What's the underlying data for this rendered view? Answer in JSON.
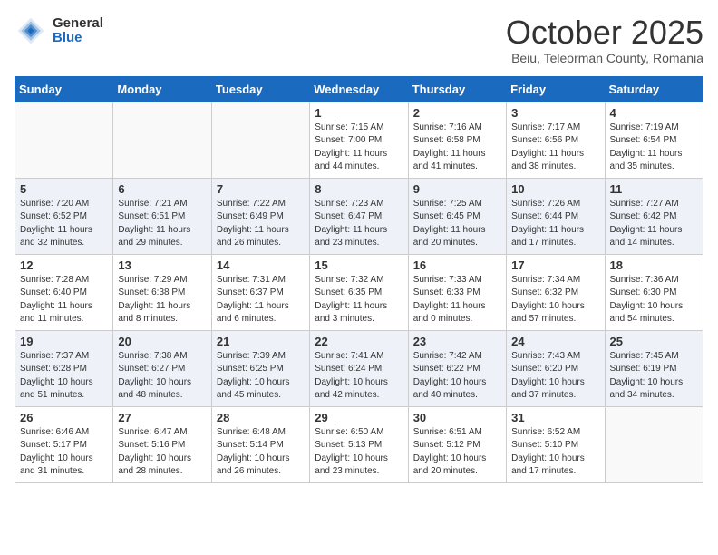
{
  "header": {
    "logo_general": "General",
    "logo_blue": "Blue",
    "month_title": "October 2025",
    "location": "Beiu, Teleorman County, Romania"
  },
  "weekdays": [
    "Sunday",
    "Monday",
    "Tuesday",
    "Wednesday",
    "Thursday",
    "Friday",
    "Saturday"
  ],
  "weeks": [
    [
      {
        "day": "",
        "info": ""
      },
      {
        "day": "",
        "info": ""
      },
      {
        "day": "",
        "info": ""
      },
      {
        "day": "1",
        "info": "Sunrise: 7:15 AM\nSunset: 7:00 PM\nDaylight: 11 hours and 44 minutes."
      },
      {
        "day": "2",
        "info": "Sunrise: 7:16 AM\nSunset: 6:58 PM\nDaylight: 11 hours and 41 minutes."
      },
      {
        "day": "3",
        "info": "Sunrise: 7:17 AM\nSunset: 6:56 PM\nDaylight: 11 hours and 38 minutes."
      },
      {
        "day": "4",
        "info": "Sunrise: 7:19 AM\nSunset: 6:54 PM\nDaylight: 11 hours and 35 minutes."
      }
    ],
    [
      {
        "day": "5",
        "info": "Sunrise: 7:20 AM\nSunset: 6:52 PM\nDaylight: 11 hours and 32 minutes."
      },
      {
        "day": "6",
        "info": "Sunrise: 7:21 AM\nSunset: 6:51 PM\nDaylight: 11 hours and 29 minutes."
      },
      {
        "day": "7",
        "info": "Sunrise: 7:22 AM\nSunset: 6:49 PM\nDaylight: 11 hours and 26 minutes."
      },
      {
        "day": "8",
        "info": "Sunrise: 7:23 AM\nSunset: 6:47 PM\nDaylight: 11 hours and 23 minutes."
      },
      {
        "day": "9",
        "info": "Sunrise: 7:25 AM\nSunset: 6:45 PM\nDaylight: 11 hours and 20 minutes."
      },
      {
        "day": "10",
        "info": "Sunrise: 7:26 AM\nSunset: 6:44 PM\nDaylight: 11 hours and 17 minutes."
      },
      {
        "day": "11",
        "info": "Sunrise: 7:27 AM\nSunset: 6:42 PM\nDaylight: 11 hours and 14 minutes."
      }
    ],
    [
      {
        "day": "12",
        "info": "Sunrise: 7:28 AM\nSunset: 6:40 PM\nDaylight: 11 hours and 11 minutes."
      },
      {
        "day": "13",
        "info": "Sunrise: 7:29 AM\nSunset: 6:38 PM\nDaylight: 11 hours and 8 minutes."
      },
      {
        "day": "14",
        "info": "Sunrise: 7:31 AM\nSunset: 6:37 PM\nDaylight: 11 hours and 6 minutes."
      },
      {
        "day": "15",
        "info": "Sunrise: 7:32 AM\nSunset: 6:35 PM\nDaylight: 11 hours and 3 minutes."
      },
      {
        "day": "16",
        "info": "Sunrise: 7:33 AM\nSunset: 6:33 PM\nDaylight: 11 hours and 0 minutes."
      },
      {
        "day": "17",
        "info": "Sunrise: 7:34 AM\nSunset: 6:32 PM\nDaylight: 10 hours and 57 minutes."
      },
      {
        "day": "18",
        "info": "Sunrise: 7:36 AM\nSunset: 6:30 PM\nDaylight: 10 hours and 54 minutes."
      }
    ],
    [
      {
        "day": "19",
        "info": "Sunrise: 7:37 AM\nSunset: 6:28 PM\nDaylight: 10 hours and 51 minutes."
      },
      {
        "day": "20",
        "info": "Sunrise: 7:38 AM\nSunset: 6:27 PM\nDaylight: 10 hours and 48 minutes."
      },
      {
        "day": "21",
        "info": "Sunrise: 7:39 AM\nSunset: 6:25 PM\nDaylight: 10 hours and 45 minutes."
      },
      {
        "day": "22",
        "info": "Sunrise: 7:41 AM\nSunset: 6:24 PM\nDaylight: 10 hours and 42 minutes."
      },
      {
        "day": "23",
        "info": "Sunrise: 7:42 AM\nSunset: 6:22 PM\nDaylight: 10 hours and 40 minutes."
      },
      {
        "day": "24",
        "info": "Sunrise: 7:43 AM\nSunset: 6:20 PM\nDaylight: 10 hours and 37 minutes."
      },
      {
        "day": "25",
        "info": "Sunrise: 7:45 AM\nSunset: 6:19 PM\nDaylight: 10 hours and 34 minutes."
      }
    ],
    [
      {
        "day": "26",
        "info": "Sunrise: 6:46 AM\nSunset: 5:17 PM\nDaylight: 10 hours and 31 minutes."
      },
      {
        "day": "27",
        "info": "Sunrise: 6:47 AM\nSunset: 5:16 PM\nDaylight: 10 hours and 28 minutes."
      },
      {
        "day": "28",
        "info": "Sunrise: 6:48 AM\nSunset: 5:14 PM\nDaylight: 10 hours and 26 minutes."
      },
      {
        "day": "29",
        "info": "Sunrise: 6:50 AM\nSunset: 5:13 PM\nDaylight: 10 hours and 23 minutes."
      },
      {
        "day": "30",
        "info": "Sunrise: 6:51 AM\nSunset: 5:12 PM\nDaylight: 10 hours and 20 minutes."
      },
      {
        "day": "31",
        "info": "Sunrise: 6:52 AM\nSunset: 5:10 PM\nDaylight: 10 hours and 17 minutes."
      },
      {
        "day": "",
        "info": ""
      }
    ]
  ]
}
